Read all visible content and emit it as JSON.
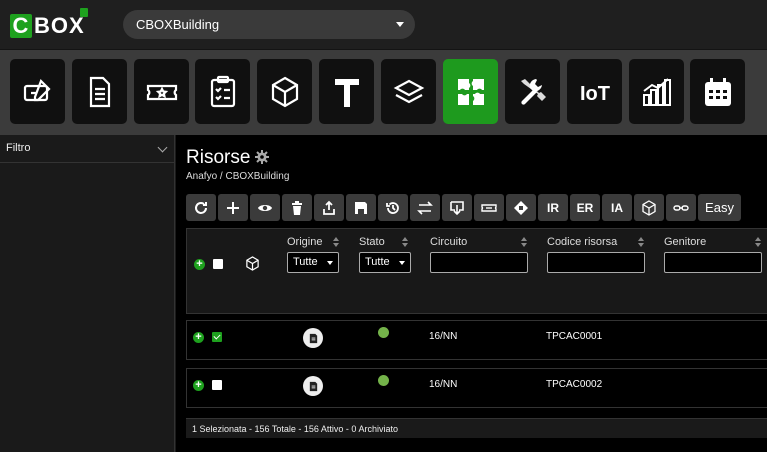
{
  "app": {
    "logo_text": "BOX",
    "logo_letter": "C",
    "building_select": "CBOXBuilding"
  },
  "modules": [
    {
      "icon": "edit-ticket-icon"
    },
    {
      "icon": "document-icon"
    },
    {
      "icon": "tickets-icon"
    },
    {
      "icon": "clipboard-checklist-icon"
    },
    {
      "icon": "cube-icon"
    },
    {
      "icon": "text-t-icon",
      "label": "T"
    },
    {
      "icon": "layers-icon"
    },
    {
      "icon": "puzzle-icon",
      "active": true
    },
    {
      "icon": "tools-icon"
    },
    {
      "icon": "iot-icon",
      "label": "IoT"
    },
    {
      "icon": "bar-chart-icon"
    },
    {
      "icon": "calendar-icon"
    }
  ],
  "sidebar": {
    "filter_label": "Filtro"
  },
  "page": {
    "title": "Risorse",
    "breadcrumb": "Anafyo / CBOXBuilding"
  },
  "actions": [
    {
      "name": "refresh-button",
      "icon": "refresh-icon"
    },
    {
      "name": "add-button",
      "icon": "plus-icon"
    },
    {
      "name": "view-button",
      "icon": "eye-icon"
    },
    {
      "name": "delete-button",
      "icon": "trash-icon"
    },
    {
      "name": "export-button",
      "icon": "upload-icon"
    },
    {
      "name": "save-button",
      "icon": "save-icon"
    },
    {
      "name": "history-button",
      "icon": "history-icon"
    },
    {
      "name": "swap-button",
      "icon": "swap-icon"
    },
    {
      "name": "import-button",
      "icon": "download-icon"
    },
    {
      "name": "ticket-button",
      "icon": "ticket-icon"
    },
    {
      "name": "puzzle-button",
      "icon": "puzzle-icon"
    },
    {
      "name": "ir-button",
      "label": "IR"
    },
    {
      "name": "er-button",
      "label": "ER"
    },
    {
      "name": "ia-button",
      "label": "IA"
    },
    {
      "name": "cube-button",
      "icon": "cube-icon"
    },
    {
      "name": "link-button",
      "icon": "link-icon"
    },
    {
      "name": "easy-button",
      "label": "Easy"
    }
  ],
  "table": {
    "columns": [
      "Origine",
      "Stato",
      "Circuito",
      "Codice risorsa",
      "Genitore"
    ],
    "filters": {
      "origine": "Tutte",
      "stato": "Tutte"
    },
    "rows": [
      {
        "selected": true,
        "circuito": "16/NN",
        "codice": "TPCAC0001",
        "status_color": "#74b34a"
      },
      {
        "selected": false,
        "circuito": "16/NN",
        "codice": "TPCAC0002",
        "status_color": "#74b34a"
      }
    ]
  },
  "status_bar": "1 Selezionata - 156 Totale - 156 Attivo - 0 Archiviato",
  "colors": {
    "accent": "#1ea11e",
    "status_active": "#74b34a"
  }
}
